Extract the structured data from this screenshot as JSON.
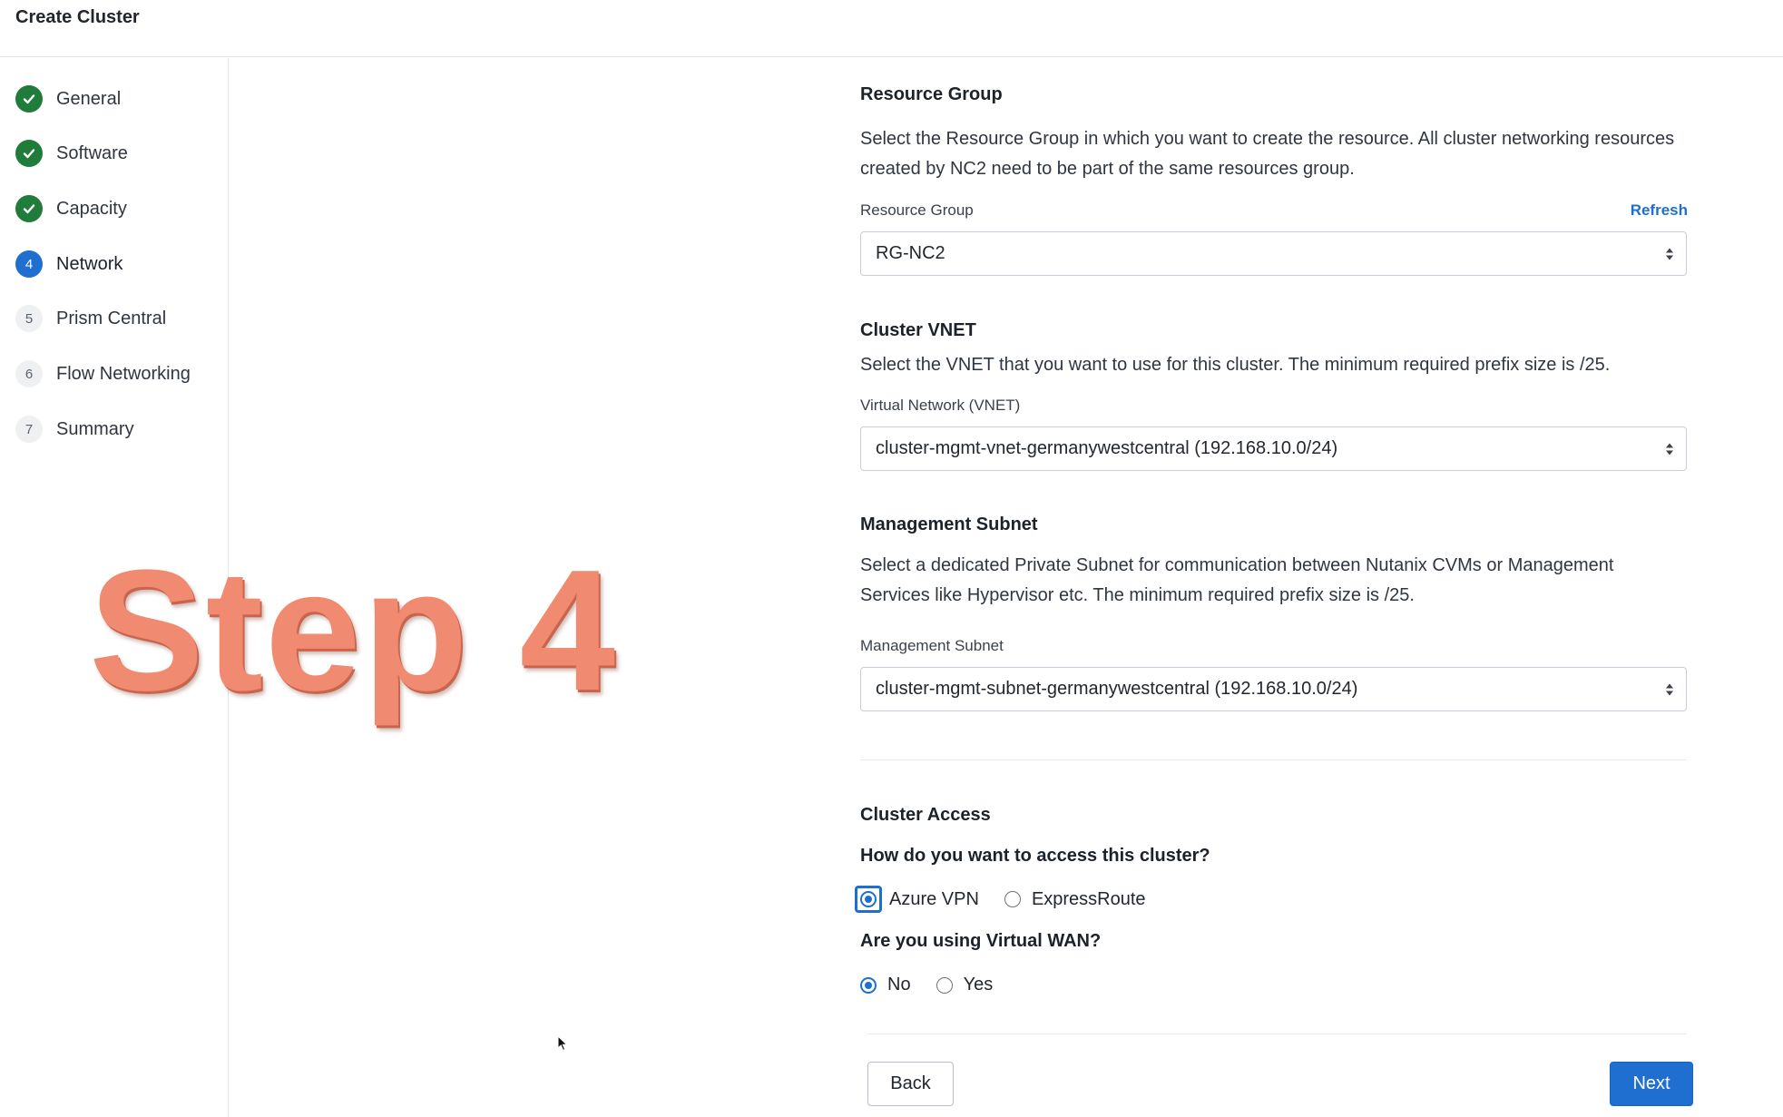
{
  "header": {
    "title": "Create Cluster"
  },
  "steps": [
    {
      "number": "",
      "label": "General",
      "status": "done"
    },
    {
      "number": "",
      "label": "Software",
      "status": "done"
    },
    {
      "number": "",
      "label": "Capacity",
      "status": "done"
    },
    {
      "number": "4",
      "label": "Network",
      "status": "current"
    },
    {
      "number": "5",
      "label": "Prism Central",
      "status": "todo"
    },
    {
      "number": "6",
      "label": "Flow Networking",
      "status": "todo"
    },
    {
      "number": "7",
      "label": "Summary",
      "status": "todo"
    }
  ],
  "overlay": {
    "text": "Step 4",
    "color": "#f08a71"
  },
  "resource_group": {
    "title": "Resource Group",
    "description": "Select the Resource Group in which you want to create the resource. All cluster networking resources created by NC2 need to be part of the same resources group.",
    "field_label": "Resource Group",
    "refresh_label": "Refresh",
    "selected_value": "RG-NC2"
  },
  "cluster_vnet": {
    "title": "Cluster VNET",
    "description": "Select the VNET that you want to use for this cluster. The minimum required prefix size is /25.",
    "field_label": "Virtual Network (VNET)",
    "selected_value": "cluster-mgmt-vnet-germanywestcentral (192.168.10.0/24)"
  },
  "management_subnet": {
    "title": "Management Subnet",
    "description": "Select a dedicated Private Subnet for communication between Nutanix CVMs or Management Services like Hypervisor etc. The minimum required prefix size is /25.",
    "field_label": "Management Subnet",
    "selected_value": "cluster-mgmt-subnet-germanywestcentral (192.168.10.0/24)"
  },
  "cluster_access": {
    "title": "Cluster Access",
    "question": "How do you want to access this cluster?",
    "options": [
      {
        "label": "Azure VPN",
        "selected": true
      },
      {
        "label": "ExpressRoute",
        "selected": false
      }
    ],
    "wan_question": "Are you using Virtual WAN?",
    "wan_options": [
      {
        "label": "No",
        "selected": true
      },
      {
        "label": "Yes",
        "selected": false
      }
    ]
  },
  "footer": {
    "back_label": "Back",
    "next_label": "Next"
  },
  "colors": {
    "accent": "#1f6fd1",
    "done": "#1f7c3a"
  }
}
